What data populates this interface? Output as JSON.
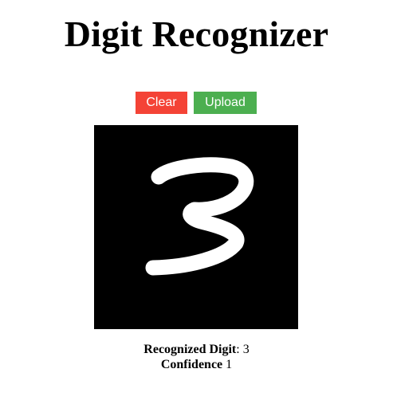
{
  "page": {
    "title": "Digit Recognizer"
  },
  "toolbar": {
    "clear_label": "Clear",
    "upload_label": "Upload",
    "clear_color": "#f44336",
    "upload_color": "#4caf50"
  },
  "canvas": {
    "background": "#000000",
    "stroke_color": "#ffffff",
    "drawn_content": "handwritten digit 3"
  },
  "result": {
    "digit_label": "Recognized Digit",
    "digit_separator": ":",
    "digit_value": "3",
    "confidence_label": "Confidence",
    "confidence_value": "1"
  }
}
